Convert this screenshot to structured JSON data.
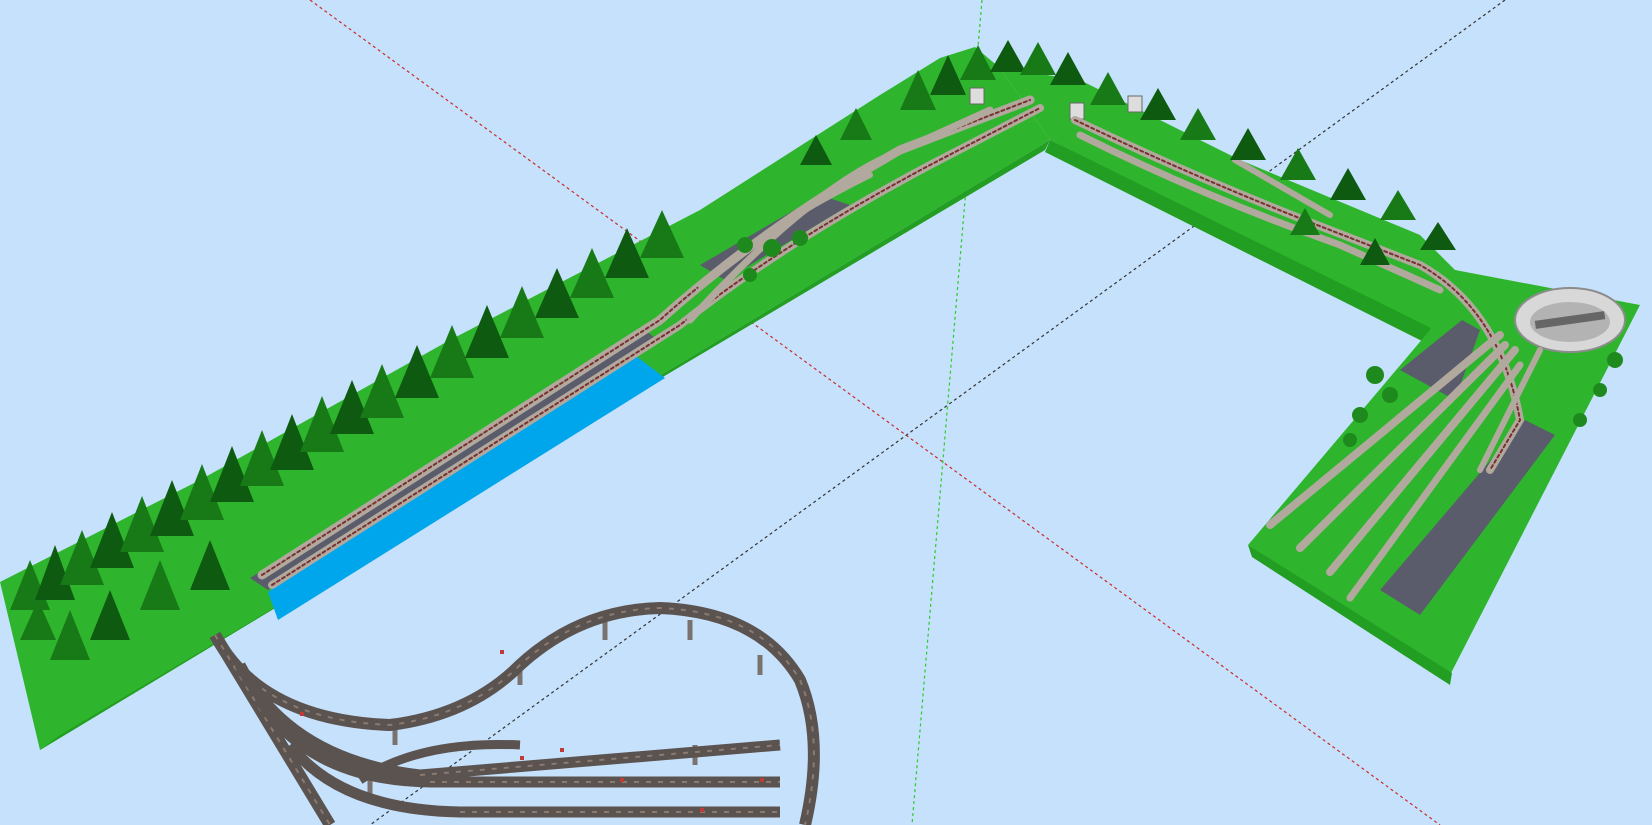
{
  "scene": {
    "type": "3d-model-railway-layout-viewport",
    "background_color": "#c6e1fb",
    "colors": {
      "terrain": "#2fb52d",
      "terrain_edge": "#25a025",
      "trees": "#177a17",
      "water": "#00a6ec",
      "road": "#5a5c6c",
      "track_ballast": "#b2a99e",
      "track_rails": "#7a3030",
      "viaduct_deck": "#5b5350",
      "axis_red": "#cc2b2b",
      "axis_green": "#2bcc2b",
      "axis_black": "#333333"
    },
    "objects": [
      "terrain-board",
      "conifer-forest",
      "river",
      "main-line-tracks",
      "station-yard",
      "turntable",
      "tunnel-portals",
      "helix-viaduct",
      "platform-roads"
    ],
    "axes": [
      "red-axis",
      "green-axis",
      "black-axis"
    ]
  }
}
